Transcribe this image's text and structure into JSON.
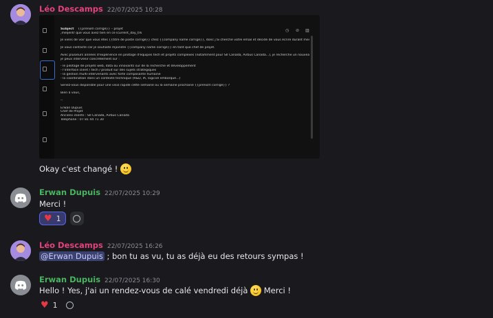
{
  "messages": [
    {
      "author": "Léo Descamps",
      "timestamp": "22/07/2025 10:28",
      "screenshot": {
        "subject_label": "Subject",
        "subject_value": "{{prénom corrigé}} – projet",
        "lines": [
          ",meljentr que vous avez tien en ce lcurrent_day_trk",
          "",
          "Je viens de voir que vous êtes {{titre de poste corrigé}} chez {{company name corrigé}}, donc j'ai cherché votre email et décidé de vous écrire durant mes vacances.",
          "",
          "Je vous contacte car je souhaite rejoindre {{company name corrigé}} en tant que chef de projet.",
          "",
          "Avec plusieurs années d'expérience en pilotage d'équipes tech et projets complexes (notamment pour SII Canada, Airbus Canada...), je recherche un nouveau défi où",
          "je peux intervenir concrètement sur :",
          "",
          "- le pilotage de projets web, data ou innovants sur de la recherche et développement",
          "- l'interface client / tech / produit sur des sujets stratégiques",
          "- la gestion multi-intervenants avec forte composante humaine",
          "- la coordination dans un contexte technique (R&D, IA, logiciel embarqué...)",
          "",
          "Seriez-vous disponible pour une visio rapide cette semaine ou la semaine prochaine {{prénom corrigé}} ?",
          "",
          "Bien à vous,",
          "",
          "--",
          "",
          "Erwan Dupuis",
          "Chef de Projet",
          "Anciens clients : SII Canada, Airbus Canada",
          "Téléphone : 07 81 44 71 30"
        ]
      },
      "text": "Okay c'est changé !"
    },
    {
      "author": "Erwan Dupuis",
      "timestamp": "22/07/2025 10:29",
      "text": "Merci !",
      "reaction_count": "1"
    },
    {
      "author": "Léo Descamps",
      "timestamp": "22/07/2025 16:26",
      "mention": "@Erwan Dupuis",
      "text": " ; bon tu as vu, tu as déjà eu des retours sympas !"
    },
    {
      "author": "Erwan Dupuis",
      "timestamp": "22/07/2025 16:30",
      "text_before": "Hello ! Yes, j'ai un rendez-vous de calé vendredi déjà",
      "text_after": " Merci !",
      "reaction_count": "1"
    }
  ],
  "colors": {
    "background": "#1a1a1e",
    "leo_name": "#e5427b",
    "erwan_name": "#4ab560",
    "mention_bg": "#3c4270"
  },
  "icons": [
    "smile-emoji-icon",
    "heart-icon",
    "add-reaction-icon",
    "discord-logo-icon"
  ]
}
